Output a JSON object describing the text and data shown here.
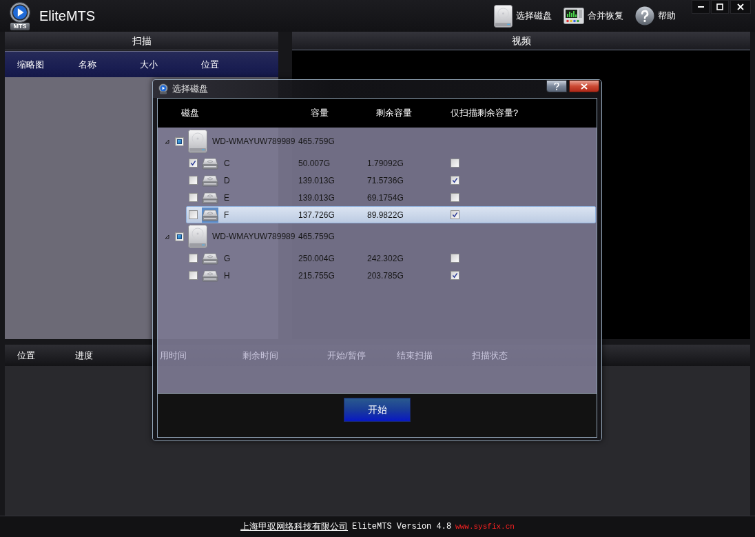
{
  "app": {
    "title": "EliteMTS",
    "logo_text": "MTS"
  },
  "toolbar": [
    {
      "kind": "disk",
      "label": "选择磁盘"
    },
    {
      "kind": "merge",
      "label": "合并恢复"
    },
    {
      "kind": "help",
      "label": "帮助"
    }
  ],
  "scan_panel": {
    "title": "扫描",
    "columns": [
      "缩略图",
      "名称",
      "大小",
      "位置"
    ]
  },
  "video_panel": {
    "title": "视频"
  },
  "progress_panel": {
    "columns": [
      "位置",
      "进度",
      "用时间",
      "剩余时间",
      "开始/暂停",
      "结束扫描",
      "扫描状态"
    ]
  },
  "dialog": {
    "title": "选择磁盘",
    "columns": [
      "磁盘",
      "容量",
      "剩余容量",
      "仅扫描剩余容量?"
    ],
    "disks": [
      {
        "name": "WD-WMAYUW789989",
        "capacity": "465.759G",
        "expanded": true,
        "partial": true,
        "children": [
          {
            "letter": "C",
            "capacity": "50.007G",
            "free": "1.79092G",
            "checked": true,
            "scan_free_only": false,
            "selected": false
          },
          {
            "letter": "D",
            "capacity": "139.013G",
            "free": "71.5736G",
            "checked": false,
            "scan_free_only": true,
            "selected": false
          },
          {
            "letter": "E",
            "capacity": "139.013G",
            "free": "69.1754G",
            "checked": false,
            "scan_free_only": false,
            "selected": false
          },
          {
            "letter": "F",
            "capacity": "137.726G",
            "free": "89.9822G",
            "checked": false,
            "scan_free_only": true,
            "selected": true
          }
        ]
      },
      {
        "name": "WD-WMAYUW789989",
        "capacity": "465.759G",
        "expanded": true,
        "partial": true,
        "children": [
          {
            "letter": "G",
            "capacity": "250.004G",
            "free": "242.302G",
            "checked": false,
            "scan_free_only": false,
            "selected": false
          },
          {
            "letter": "H",
            "capacity": "215.755G",
            "free": "203.785G",
            "checked": false,
            "scan_free_only": true,
            "selected": false
          }
        ]
      }
    ],
    "start_button": "开始"
  },
  "footer": {
    "company": "上海甲驭网络科技有限公司",
    "version": "EliteMTS Version 4.8",
    "website": "www.sysfix.cn"
  }
}
